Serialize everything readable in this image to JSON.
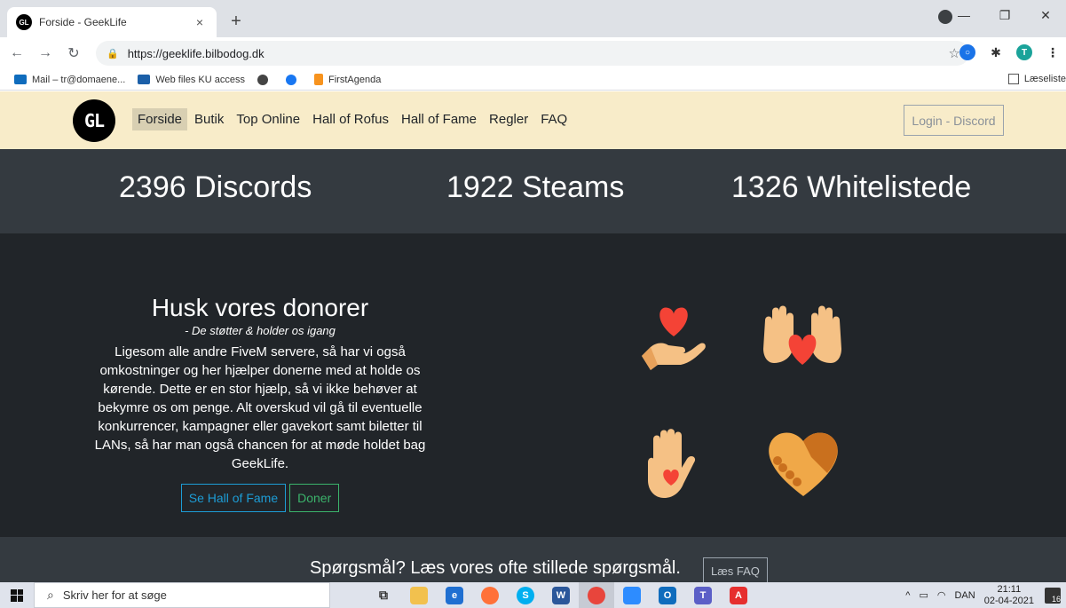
{
  "browser": {
    "tab_title": "Forside - GeekLife",
    "tab_favicon": "GL",
    "tab_close": "×",
    "new_tab": "+",
    "url": "https://geeklife.bilbodog.dk",
    "profile_initial": "T",
    "bookmarks": [
      {
        "label": "Mail – tr@domaene...",
        "color": "#0f6cbd"
      },
      {
        "label": "Web files KU access",
        "color": "#1b5fa8"
      },
      {
        "label": "",
        "color": "#444444"
      },
      {
        "label": "",
        "color": "#1877f2"
      },
      {
        "label": "FirstAgenda",
        "color": "#f7931e"
      }
    ],
    "reading_list": "Læseliste"
  },
  "site": {
    "logo_text": "GL",
    "nav": {
      "home": "Forside",
      "shop": "Butik",
      "top_online": "Top Online",
      "hall_of_rofus": "Hall of Rofus",
      "hall_of_fame": "Hall of Fame",
      "rules": "Regler",
      "faq": "FAQ"
    },
    "login": "Login - Discord",
    "stats": {
      "discords": "2396 Discords",
      "steams": "1922 Steams",
      "whitelisted": "1326 Whitelistede"
    },
    "donors": {
      "title": "Husk vores donorer",
      "subtitle": "- De støtter & holder os igang",
      "body": "Ligesom alle andre FiveM servere, så har vi også omkostninger og her hjælper donerne med at holde os kørende. Dette er en stor hjælp, så vi ikke behøver at bekymre os om penge. Alt overskud vil gå til eventuelle konkurrencer, kampagner eller gavekort samt biletter til LANs, så har man også chancen for at møde holdet bag GeekLife.",
      "btn_hof": "Se Hall of Fame",
      "btn_donate": "Doner"
    },
    "faq_band": {
      "text": "Spørgsmål? Læs vores ofte stillede spørgsmål.",
      "button": "Læs FAQ"
    },
    "colors": {
      "nav_bg": "#f8ecc9",
      "stats_bg": "#343a40",
      "donor_bg": "#212529",
      "heart": "#f44336",
      "skin": "#f5c185"
    }
  },
  "taskbar": {
    "search_placeholder": "Skriv her for at søge",
    "language": "DAN",
    "time": "21:11",
    "date": "02-04-2021",
    "notifications": "16"
  }
}
